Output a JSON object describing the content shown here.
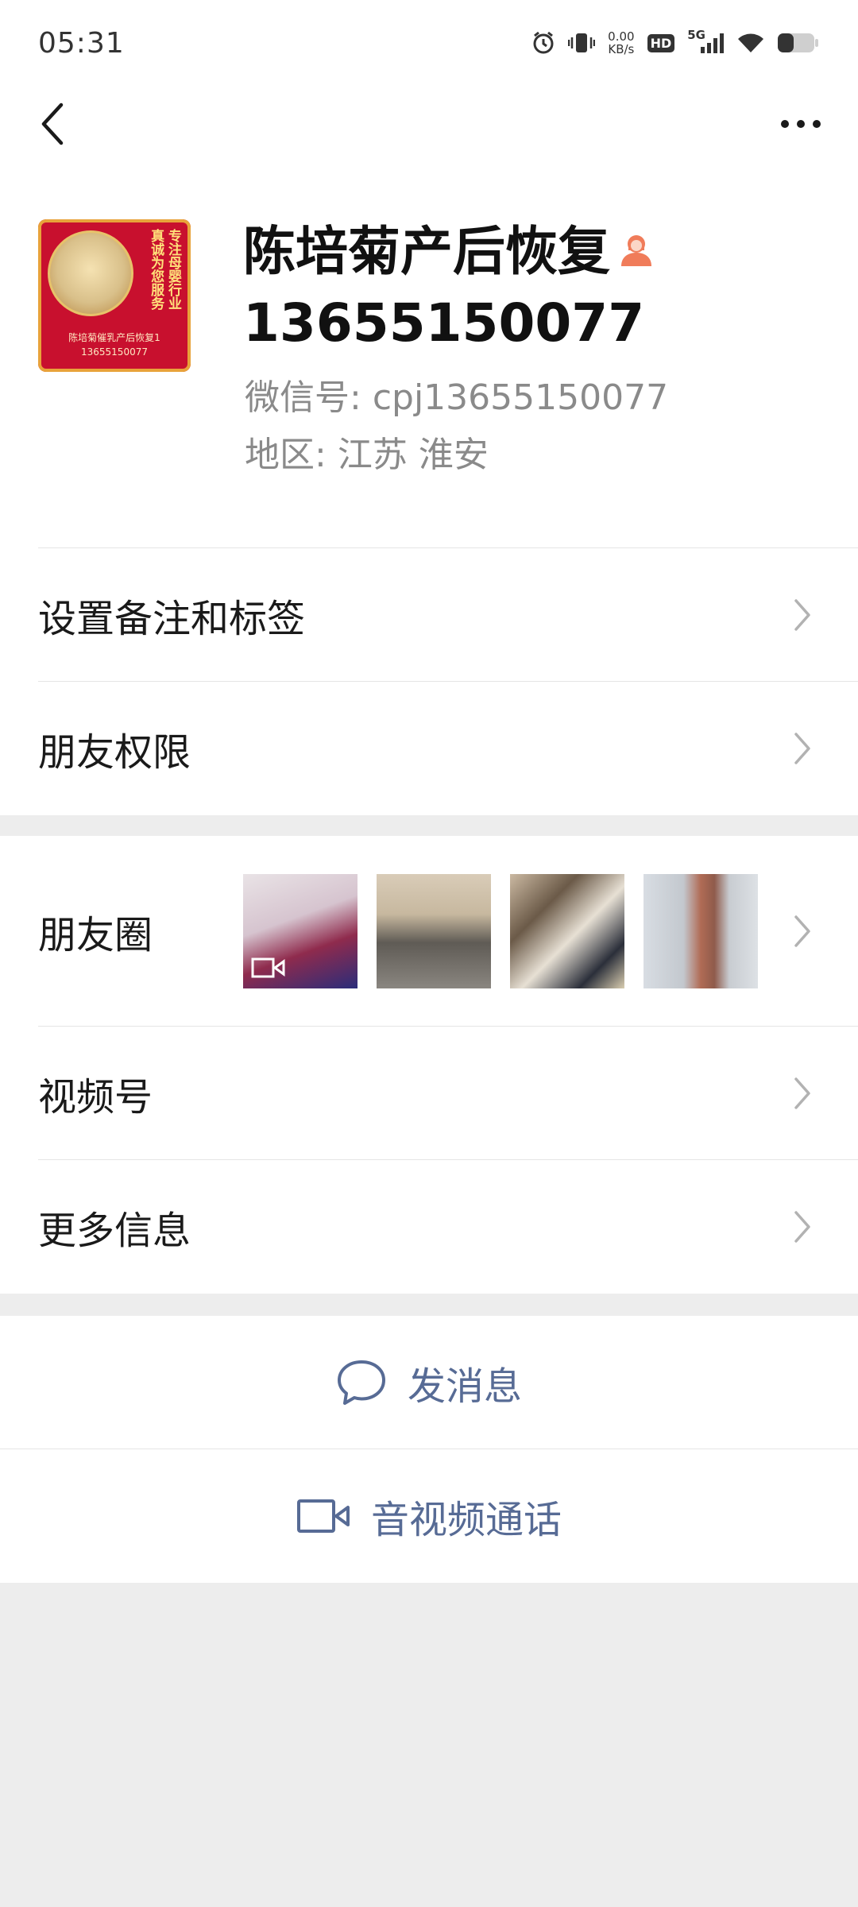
{
  "status_bar": {
    "time": "05:31",
    "net_speed_value": "0.00",
    "net_speed_unit": "KB/s",
    "hd": "HD",
    "signal": "5G",
    "icons": [
      "alarm-icon",
      "vibrate-icon",
      "signal-icon",
      "wifi-icon",
      "battery-icon"
    ]
  },
  "nav": {
    "back_icon": "chevron-left-icon",
    "more_icon": "more-dots-icon"
  },
  "profile": {
    "name_line1": "陈培菊产后恢复",
    "name_line2": "13655150077",
    "gender_icon": "female-user-icon",
    "wechat_id_label": "微信号:",
    "wechat_id": "cpj13655150077",
    "region_label": "地区:",
    "region": "江苏  淮安",
    "avatar": {
      "vertical_text_1": "专注母婴行业",
      "vertical_text_2": "真诚为您服务",
      "caption_line1": "陈培菊催乳产后恢复1",
      "caption_line2": "13655150077",
      "bg_color": "#c8102e"
    }
  },
  "group1": {
    "items": [
      {
        "label": "设置备注和标签"
      },
      {
        "label": "朋友权限"
      }
    ]
  },
  "group2": {
    "moments_label": "朋友圈",
    "items": [
      {
        "label": "视频号"
      },
      {
        "label": "更多信息"
      }
    ]
  },
  "actions": {
    "message_label": "发消息",
    "call_label": "音视频通话",
    "accent_color": "#576b95"
  }
}
